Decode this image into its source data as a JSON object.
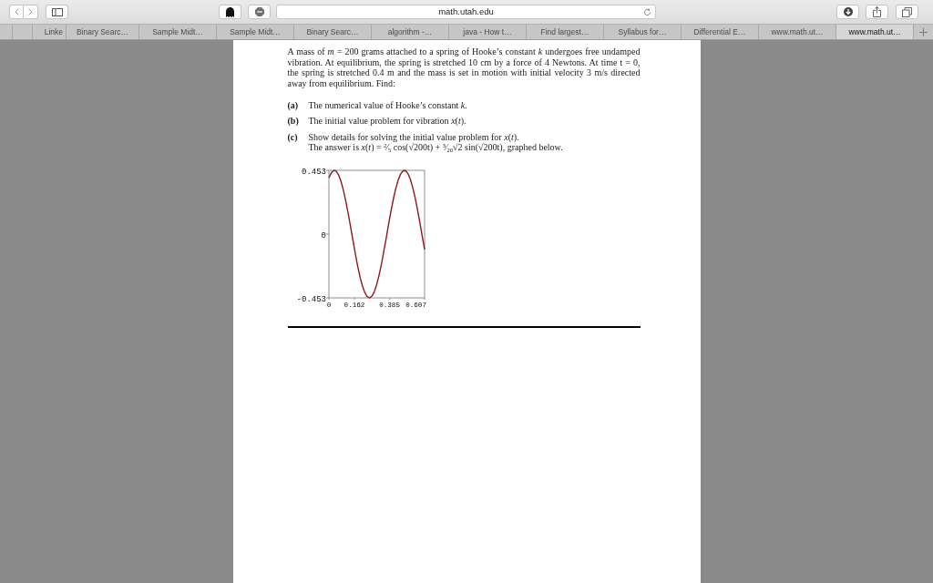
{
  "toolbar": {
    "address": "math.utah.edu"
  },
  "tabs": [
    {
      "label": "Linke",
      "selected": false
    },
    {
      "label": "Binary Searc…",
      "selected": false
    },
    {
      "label": "Sample Midt…",
      "selected": false
    },
    {
      "label": "Sample Midt…",
      "selected": false
    },
    {
      "label": "Binary Searc…",
      "selected": false
    },
    {
      "label": "algorithm -…",
      "selected": false
    },
    {
      "label": "java - How t…",
      "selected": false
    },
    {
      "label": "Find largest…",
      "selected": false
    },
    {
      "label": "Syllabus for…",
      "selected": false
    },
    {
      "label": "Differential E…",
      "selected": false
    },
    {
      "label": "www.math.ut…",
      "selected": false
    },
    {
      "label": "www.math.ut…",
      "selected": true
    }
  ],
  "document": {
    "intro": "A mass of *m* = 200 grams attached to a spring of Hooke’s constant *k* undergoes free undamped vibration. At equilibrium, the spring is stretched 10 cm by a force of 4 Newtons. At time t = 0, the spring is stretched 0.4 m and the mass is set in motion with initial velocity 3 m/s directed away from equilibrium. Find:",
    "questions": [
      {
        "marker": "(a)",
        "text": "The numerical value of Hooke’s constant *k*."
      },
      {
        "marker": "(b)",
        "text": "The initial value problem for vibration *x*(*t*)."
      },
      {
        "marker": "(c)",
        "text": "Show details for solving the initial value problem for *x*(*t*).",
        "answer": "The answer is *x*(*t*) = $^{2}$⁄$_{5}$ cos(√200t) + $^{3}$⁄$_{20}$√2 sin(√200t), graphed below."
      }
    ],
    "chart_data": {
      "type": "line",
      "x": [
        0,
        0.0152,
        0.0304,
        0.0455,
        0.0607,
        0.0759,
        0.0911,
        0.1062,
        0.1214,
        0.1366,
        0.1518,
        0.1669,
        0.1821,
        0.1973,
        0.2125,
        0.2276,
        0.2428,
        0.258,
        0.2732,
        0.2883,
        0.3035,
        0.3187,
        0.3339,
        0.349,
        0.3642,
        0.3794,
        0.3946,
        0.4097,
        0.4249,
        0.4401,
        0.4553,
        0.4704,
        0.4856,
        0.5008,
        0.516,
        0.5311,
        0.5463,
        0.5615,
        0.5767,
        0.5918,
        0.607
      ],
      "series": [
        {
          "color": "#8b1a1a",
          "values": [
            0.4,
            0.436,
            0.452,
            0.447,
            0.422,
            0.377,
            0.315,
            0.239,
            0.152,
            0.057,
            -0.04,
            -0.135,
            -0.225,
            -0.305,
            -0.367,
            -0.415,
            -0.444,
            -0.453,
            -0.44,
            -0.408,
            -0.357,
            -0.289,
            -0.209,
            -0.118,
            -0.023,
            0.075,
            0.169,
            0.254,
            0.326,
            0.387,
            0.428,
            0.45,
            0.451,
            0.431,
            0.392,
            0.334,
            0.261,
            0.177,
            0.084,
            -0.013,
            -0.109
          ]
        }
      ],
      "xlim": [
        0,
        0.607
      ],
      "ylim": [
        -0.453,
        0.453
      ],
      "xticks": [
        0,
        0.162,
        0.385,
        0.607
      ],
      "yticks": [
        0.453,
        0,
        -0.453
      ]
    }
  }
}
